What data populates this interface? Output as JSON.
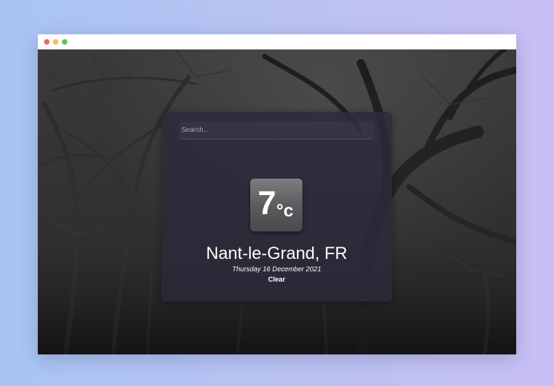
{
  "search": {
    "placeholder": "Search..."
  },
  "weather": {
    "temperature": "7",
    "unit": "°c",
    "location": "Nant-le-Grand, FR",
    "date": "Thursday 16 December 2021",
    "condition": "Clear"
  },
  "window_controls": [
    "close",
    "minimize",
    "maximize"
  ],
  "colors": {
    "background_gradient_start": "#a7c4f3",
    "background_gradient_end": "#c8c0f5",
    "card": "#2c2a3a",
    "temperature_box": "#5a5a5d",
    "text": "#ffffff"
  }
}
